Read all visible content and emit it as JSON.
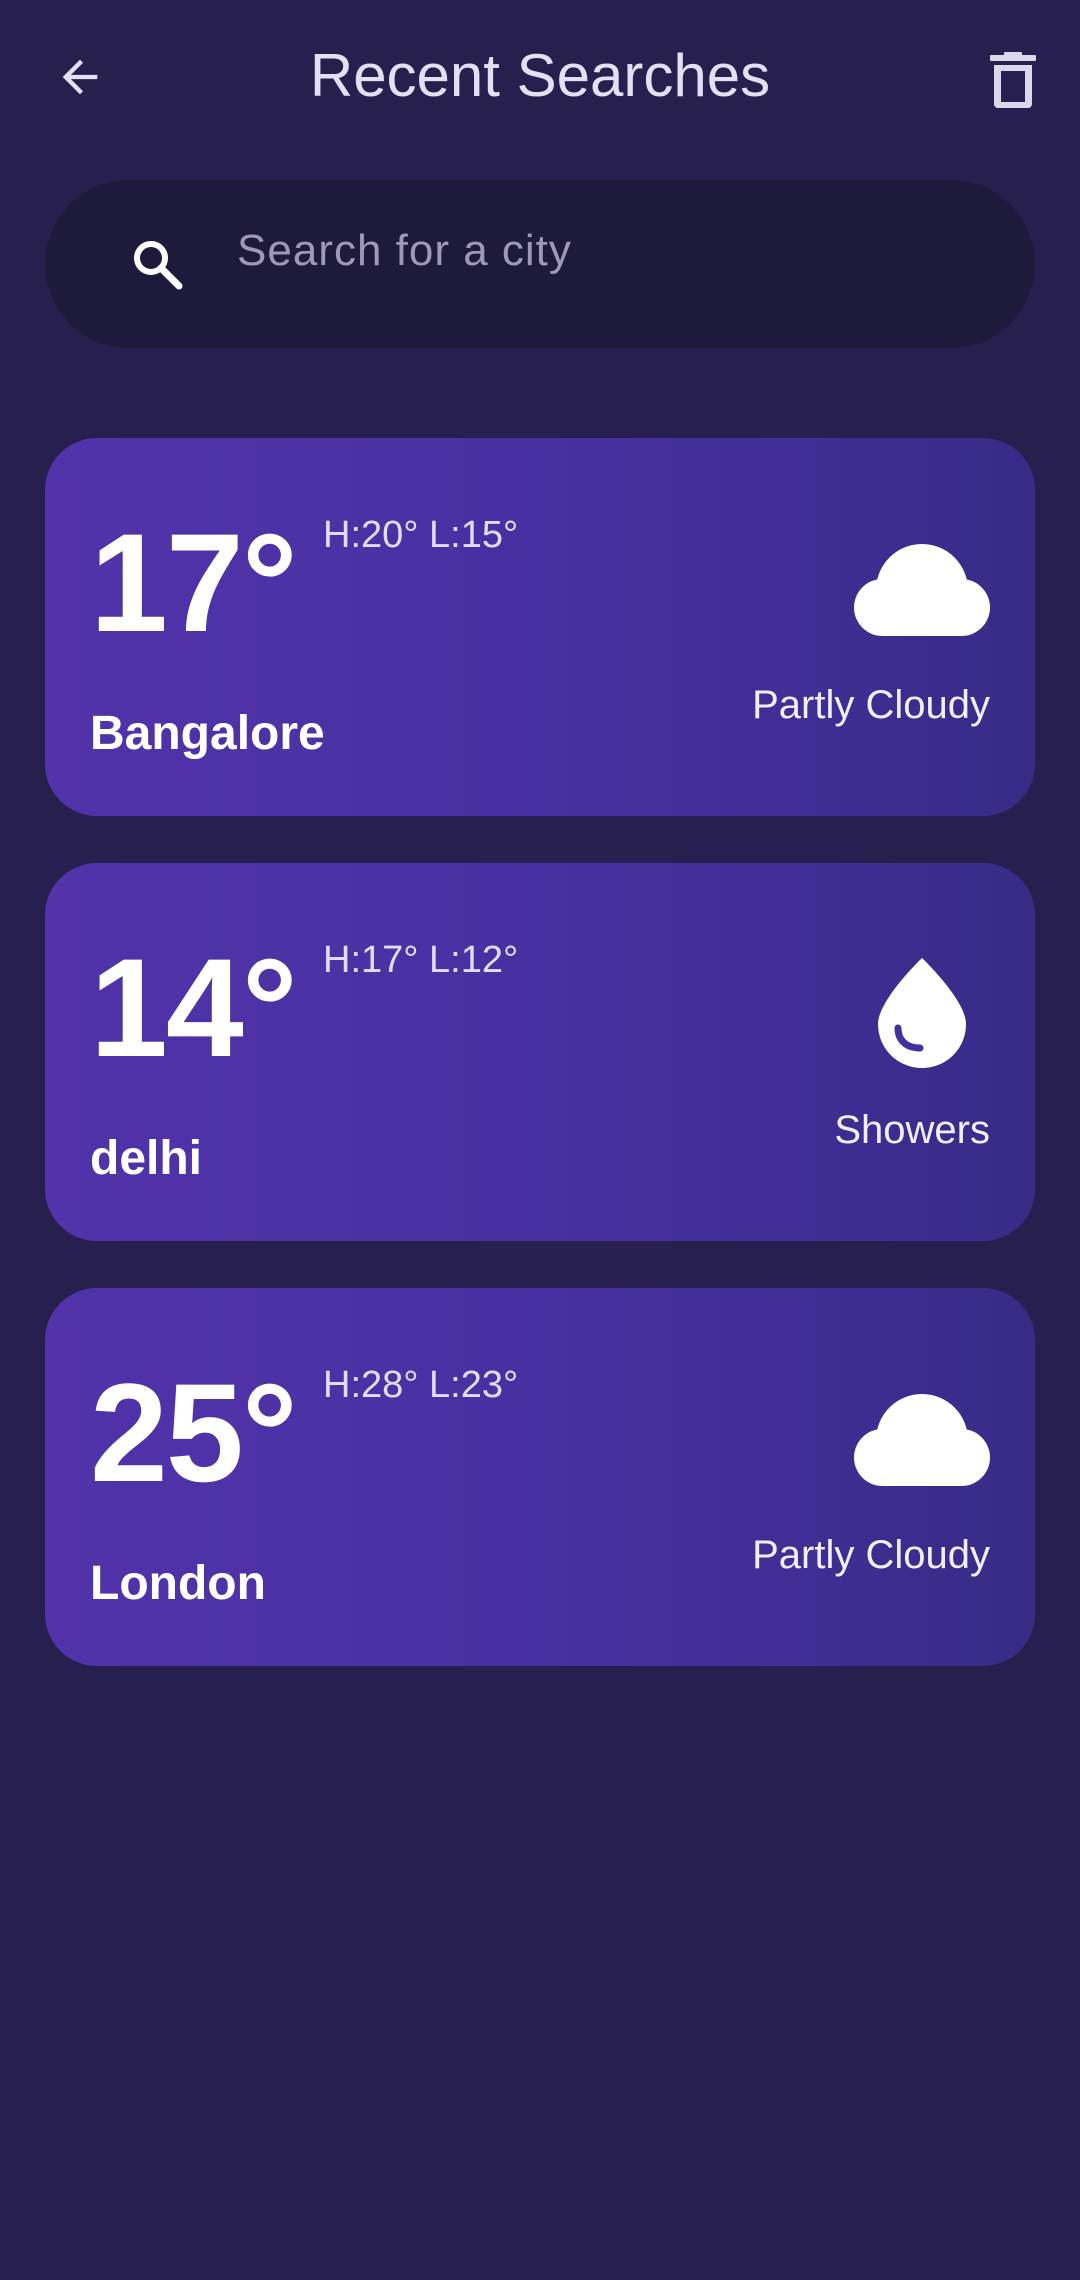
{
  "header": {
    "title": "Recent Searches",
    "back_icon": "arrow-back-icon",
    "delete_icon": "trash-icon"
  },
  "search": {
    "placeholder": "Search for a city",
    "value": "",
    "icon": "search-icon"
  },
  "cards": [
    {
      "temp": "17°",
      "hilo": "H:20° L:15°",
      "city": "Bangalore",
      "condition": "Partly Cloudy",
      "icon": "cloud-icon"
    },
    {
      "temp": "14°",
      "hilo": "H:17° L:12°",
      "city": "delhi",
      "condition": "Showers",
      "icon": "water-drop-icon"
    },
    {
      "temp": "25°",
      "hilo": "H:28° L:23°",
      "city": "London",
      "condition": "Partly Cloudy",
      "icon": "cloud-icon"
    }
  ],
  "colors": {
    "background": "#27204f",
    "search_bar": "#1e1a3b",
    "card_gradient_start": "#5233aa",
    "card_gradient_end": "#382b86",
    "text": "#ffffff"
  }
}
